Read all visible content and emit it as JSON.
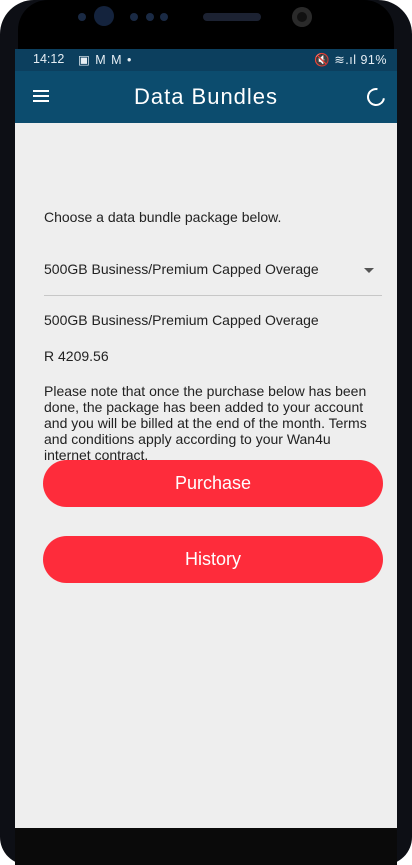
{
  "status_bar": {
    "time": "14:12",
    "notification_icons": "▣ M M •",
    "right_icons": "🔇 ≋.ıl 91%",
    "battery": "91%"
  },
  "app_bar": {
    "title": "Data Bundles",
    "menu_icon": "hamburger-menu",
    "refresh_icon": "refresh"
  },
  "main": {
    "intro_text": "Choose a data bundle package below.",
    "bundle_select": {
      "selected_value": "500GB Business/Premium Capped Overage"
    },
    "package_name": "500GB Business/Premium Capped Overage",
    "package_price": "R 4209.56",
    "note": "Please note that once the purchase below has been done, the package has been added to your account and you will be billed at the end of the month. Terms and conditions apply according to your Wan4u internet contract.",
    "purchase_button_label": "Purchase",
    "history_button_label": "History"
  },
  "colors": {
    "app_bar": "#0c4c6e",
    "status_bar": "#0c3f5e",
    "button": "#fe2c3b",
    "background": "#eeeeee"
  }
}
